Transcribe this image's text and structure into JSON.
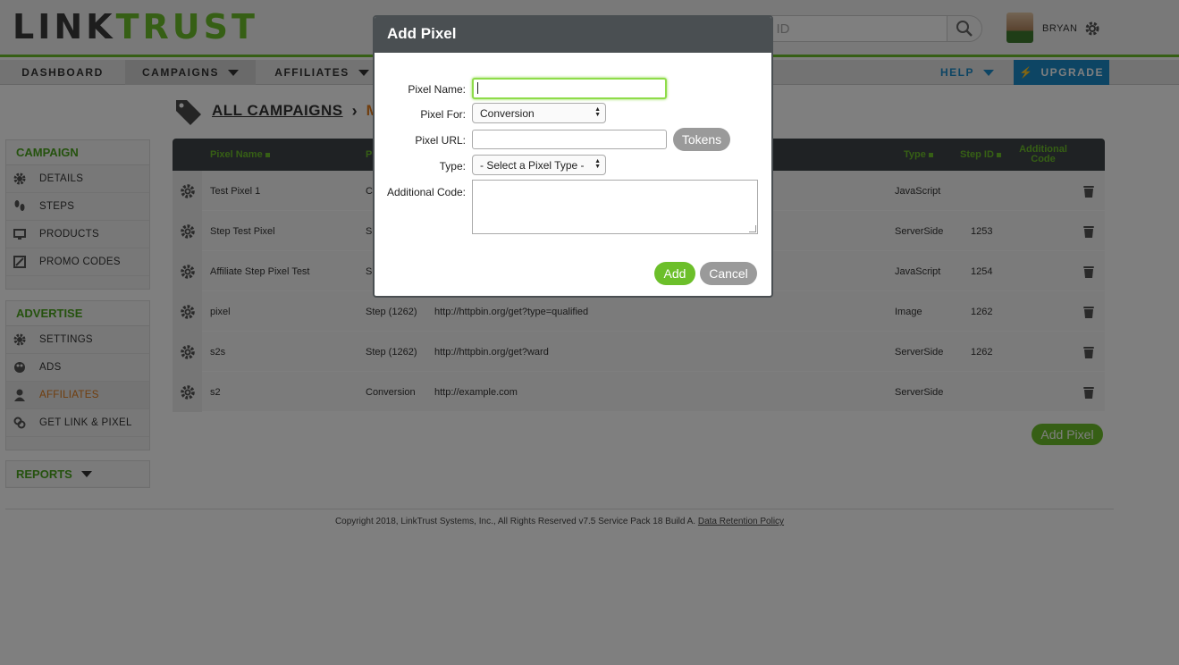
{
  "header": {
    "logo_part1": "LINK",
    "logo_part2": "TRUST",
    "search_placeholder": "or ID",
    "username": "BRYAN"
  },
  "nav": {
    "items": [
      "DASHBOARD",
      "CAMPAIGNS",
      "AFFILIATES"
    ],
    "help": "HELP",
    "upgrade": "UPGRADE"
  },
  "breadcrumb": {
    "link": "ALL CAMPAIGNS",
    "current": "M"
  },
  "sidebar": {
    "campaign": {
      "heading": "CAMPAIGN",
      "items": [
        "DETAILS",
        "STEPS",
        "PRODUCTS",
        "PROMO CODES"
      ]
    },
    "advertise": {
      "heading": "ADVERTISE",
      "items": [
        "SETTINGS",
        "ADS",
        "AFFILIATES",
        "GET LINK & PIXEL"
      ]
    },
    "reports": {
      "heading": "REPORTS"
    }
  },
  "table": {
    "headers": {
      "name": "Pixel Name",
      "pixel_for": "P",
      "type": "Type",
      "step_id": "Step ID",
      "additional": "Additional Code"
    },
    "rows": [
      {
        "name": "Test Pixel 1",
        "pixel_for": "C",
        "url": "",
        "type": "JavaScript",
        "step_id": ""
      },
      {
        "name": "Step Test Pixel",
        "pixel_for": "S",
        "url": "",
        "type": "ServerSide",
        "step_id": "1253"
      },
      {
        "name": "Affiliate Step Pixel Test",
        "pixel_for": "S",
        "url": "",
        "type": "JavaScript",
        "step_id": "1254"
      },
      {
        "name": "pixel",
        "pixel_for": "Step (1262)",
        "url": "http://httpbin.org/get?type=qualified",
        "type": "Image",
        "step_id": "1262"
      },
      {
        "name": "s2s",
        "pixel_for": "Step (1262)",
        "url": "http://httpbin.org/get?ward",
        "type": "ServerSide",
        "step_id": "1262"
      },
      {
        "name": "s2",
        "pixel_for": "Conversion",
        "url": "http://example.com",
        "type": "ServerSide",
        "step_id": ""
      }
    ],
    "add_button": "Add Pixel"
  },
  "footer": {
    "text": "Copyright 2018, LinkTrust Systems, Inc., All Rights Reserved v7.5 Service Pack 18 Build A.",
    "link": "Data Retention Policy"
  },
  "modal": {
    "title": "Add Pixel",
    "labels": {
      "name": "Pixel Name:",
      "pixel_for": "Pixel For:",
      "url": "Pixel URL:",
      "type": "Type:",
      "additional": "Additional Code:"
    },
    "pixel_name_value": "",
    "pixel_for_selected": "Conversion",
    "pixel_url_value": "",
    "type_selected": "- Select a Pixel Type -",
    "tokens_button": "Tokens",
    "add_button": "Add",
    "cancel_button": "Cancel"
  },
  "colors": {
    "brand_green": "#6cbf2a",
    "accent_orange": "#e07b1a",
    "accent_blue": "#1b8ac9",
    "dark_header": "#3f4548"
  }
}
